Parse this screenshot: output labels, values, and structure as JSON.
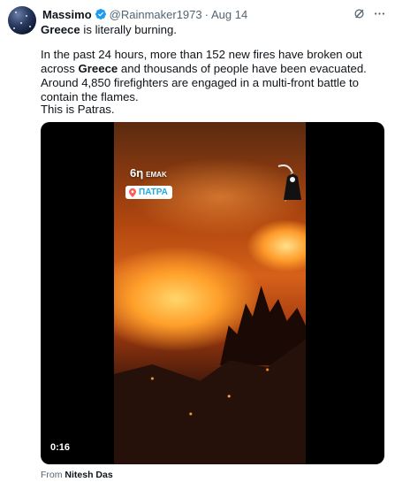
{
  "tweet": {
    "author_name": "Massimo",
    "handle": "@Rainmaker1973",
    "separator": "·",
    "date": "Aug 14",
    "line1_bold": "Greece",
    "line1_rest": " is literally burning.",
    "para2_a": "In the past 24 hours, more than 152 new fires have broken out across",
    "para2_bold": "Greece",
    "para2_b": " and thousands of people have been evacuated. Around 4,850 firefighters are engaged in a multi-front battle to contain the flames.",
    "para3": "This is Patras."
  },
  "media": {
    "overlay_text": "6η",
    "overlay_small": "ΕΜΑΚ",
    "location_badge": "ΠΑΤΡΑ",
    "duration": "0:16"
  },
  "attribution": {
    "prefix": "From ",
    "source_name": "Nitesh Das"
  },
  "icons": {
    "verified": "verified-badge-icon",
    "grok": "grok-icon",
    "more": "more-options-icon",
    "location": "location-pin-icon",
    "sticker": "grim-reaper-sticker"
  },
  "colors": {
    "verified_blue": "#1d9bf0",
    "secondary_text": "#536471",
    "primary_text": "#0f1419",
    "badge_text": "#23a8e0"
  }
}
